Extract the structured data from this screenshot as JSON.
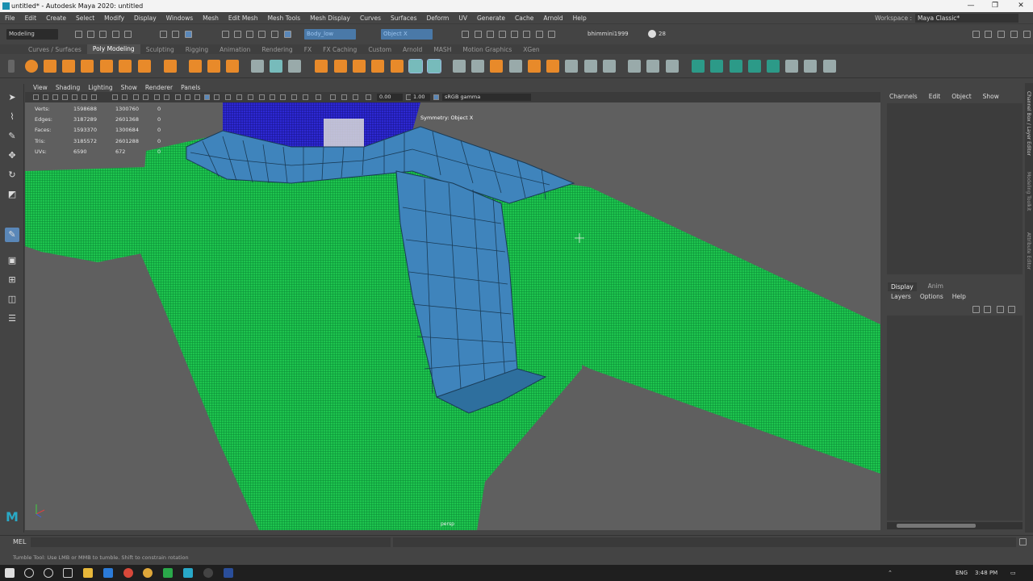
{
  "window": {
    "title": "untitled* - Autodesk Maya 2020: untitled",
    "min": "—",
    "max": "❐",
    "close": "✕"
  },
  "menubar": [
    "File",
    "Edit",
    "Create",
    "Select",
    "Modify",
    "Display",
    "Windows",
    "Mesh",
    "Edit Mesh",
    "Mesh Tools",
    "Mesh Display",
    "Curves",
    "Surfaces",
    "Deform",
    "UV",
    "Generate",
    "Cache",
    "Arnold",
    "Help"
  ],
  "workspace": {
    "label": "Workspace :",
    "value": "Maya Classic*"
  },
  "statusline": {
    "mode": "Modeling",
    "object_field": "Body_low",
    "symmetry_field": "Object X",
    "user": "bhimmini1999",
    "credits": "28"
  },
  "shelf_tabs": [
    "Curves / Surfaces",
    "Poly Modeling",
    "Sculpting",
    "Rigging",
    "Animation",
    "Rendering",
    "FX",
    "FX Caching",
    "Custom",
    "Arnold",
    "MASH",
    "Motion Graphics",
    "XGen"
  ],
  "shelf_active": "Poly Modeling",
  "viewport_menu": [
    "View",
    "Shading",
    "Lighting",
    "Show",
    "Renderer",
    "Panels"
  ],
  "viewport_toolbar": {
    "exposure": "0.00",
    "gamma": "1.00",
    "colorspace": "sRGB gamma"
  },
  "hud": {
    "rows": [
      {
        "label": "Verts:",
        "a": "1598688",
        "b": "1300760",
        "c": "0"
      },
      {
        "label": "Edges:",
        "a": "3187289",
        "b": "2601368",
        "c": "0"
      },
      {
        "label": "Faces:",
        "a": "1593370",
        "b": "1300684",
        "c": "0"
      },
      {
        "label": "Tris:",
        "a": "3185572",
        "b": "2601288",
        "c": "0"
      },
      {
        "label": "UVs:",
        "a": "6590",
        "b": "672",
        "c": "0"
      }
    ],
    "symmetry": "Symmetry: Object X",
    "camera_label": "persp"
  },
  "right_panel": {
    "header": [
      "Channels",
      "Edit",
      "Object",
      "Show"
    ],
    "layer_tabs": [
      "Display",
      "Anim"
    ],
    "layer_tab_active": "Display",
    "layer_menu": [
      "Layers",
      "Options",
      "Help"
    ],
    "vertical_tabs": [
      "Channel Box / Layer Editor",
      "Modeling Toolkit",
      "Attribute Editor"
    ]
  },
  "command_line": {
    "label": "MEL"
  },
  "help_line": "Tumble Tool: Use LMB or MMB to tumble. Shift to constrain rotation",
  "taskbar": {
    "lang": "ENG",
    "time": "3:48 PM"
  },
  "colors": {
    "mesh_green": "#16c04a",
    "mesh_blue": "#3d82b8",
    "head_blue": "#2b26c8",
    "viewport_bg": "#5f5f5f"
  }
}
